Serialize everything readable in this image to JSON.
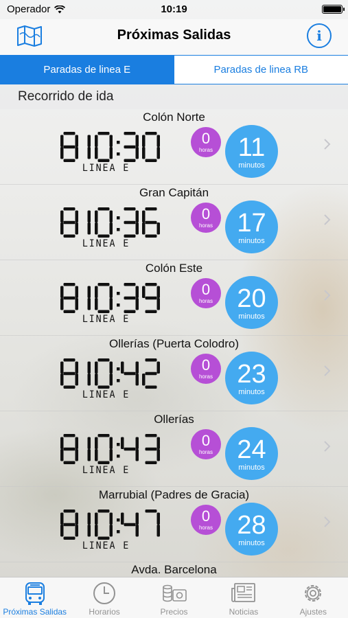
{
  "status": {
    "carrier": "Operador",
    "time": "10:19"
  },
  "nav": {
    "title": "Próximas Salidas",
    "info_icon": "info-icon",
    "map_icon": "map-icon"
  },
  "segments": {
    "left": "Paradas de linea E",
    "right": "Paradas de linea RB",
    "active": "left"
  },
  "section": {
    "title": "Recorrido de ida"
  },
  "departures": [
    {
      "stop": "Colón Norte",
      "time": "10:30",
      "line": "LINEA E",
      "hours": "0",
      "hours_unit": "horas",
      "minutes": "11",
      "minutes_unit": "minutos"
    },
    {
      "stop": "Gran Capitán",
      "time": "10:36",
      "line": "LINEA E",
      "hours": "0",
      "hours_unit": "horas",
      "minutes": "17",
      "minutes_unit": "minutos"
    },
    {
      "stop": "Colón Este",
      "time": "10:39",
      "line": "LINEA E",
      "hours": "0",
      "hours_unit": "horas",
      "minutes": "20",
      "minutes_unit": "minutos"
    },
    {
      "stop": "Ollerías (Puerta Colodro)",
      "time": "10:42",
      "line": "LINEA E",
      "hours": "0",
      "hours_unit": "horas",
      "minutes": "23",
      "minutes_unit": "minutos"
    },
    {
      "stop": "Ollerías",
      "time": "10:43",
      "line": "LINEA E",
      "hours": "0",
      "hours_unit": "horas",
      "minutes": "24",
      "minutes_unit": "minutos"
    },
    {
      "stop": "Marrubial (Padres de Gracia)",
      "time": "10:47",
      "line": "LINEA E",
      "hours": "0",
      "hours_unit": "horas",
      "minutes": "28",
      "minutes_unit": "minutos"
    }
  ],
  "partial_stop": "Avda. Barcelona",
  "tabs": [
    {
      "label": "Próximas Salidas",
      "icon": "bus-icon",
      "active": true
    },
    {
      "label": "Horarios",
      "icon": "clock-icon",
      "active": false
    },
    {
      "label": "Precios",
      "icon": "money-icon",
      "active": false
    },
    {
      "label": "Noticias",
      "icon": "newspaper-icon",
      "active": false
    },
    {
      "label": "Ajustes",
      "icon": "gear-icon",
      "active": false
    }
  ],
  "colors": {
    "accent": "#1a7ee0",
    "hours_badge": "#b64fd6",
    "minutes_badge": "#44aaf0"
  }
}
